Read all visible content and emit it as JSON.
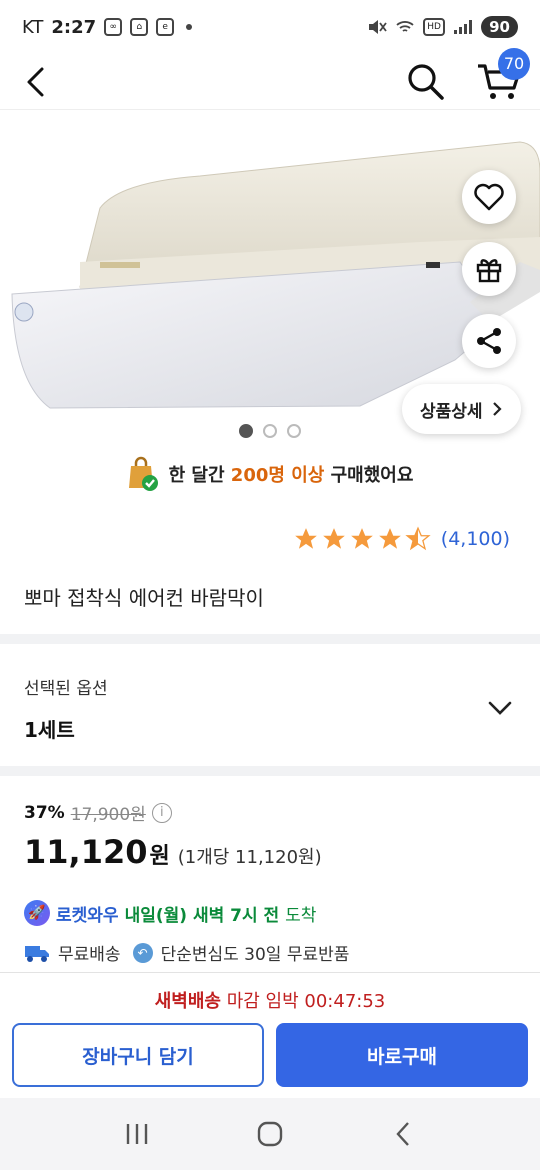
{
  "status_bar": {
    "carrier": "KT",
    "time": "2:27",
    "battery": "90"
  },
  "header": {
    "cart_count": "70",
    "icons": [
      "back-icon",
      "search-icon",
      "cart-icon"
    ]
  },
  "gallery": {
    "detail_button": "상품상세",
    "slide_count": 3,
    "active_slide": 1,
    "side_icons": [
      "heart-icon",
      "gift-icon",
      "share-icon"
    ]
  },
  "social_proof": {
    "prefix": "한 달간",
    "highlight": "200명 이상",
    "suffix": "구매했어요"
  },
  "rating": {
    "stars": 4.5,
    "count": "(4,100)"
  },
  "product": {
    "title": "뽀마 접착식 에어컨 바람막이"
  },
  "option": {
    "label": "선택된 옵션",
    "value": "1세트"
  },
  "price": {
    "discount": "37%",
    "original": "17,900원",
    "sale": "11,120",
    "won": "원",
    "unit": "(1개당 11,120원)"
  },
  "delivery": {
    "rocket": "로켓와우",
    "date": "내일(월) 새벽 7시 전",
    "suffix": "도착"
  },
  "shipping": {
    "free_shipping": "무료배송",
    "return_policy": "단순변심도 30일 무료반품"
  },
  "bottom": {
    "deadline_label": "새벽배송",
    "deadline_text": "마감 임박 00:47:53",
    "cart_button": "장바구니 담기",
    "buy_button": "바로구매"
  },
  "colors": {
    "accent_blue": "#3466e4",
    "orange_highlight": "#d9650c",
    "deadline_red": "#c01f1f",
    "delivery_green": "#0a8a3a",
    "star_orange": "#f59a3c"
  }
}
